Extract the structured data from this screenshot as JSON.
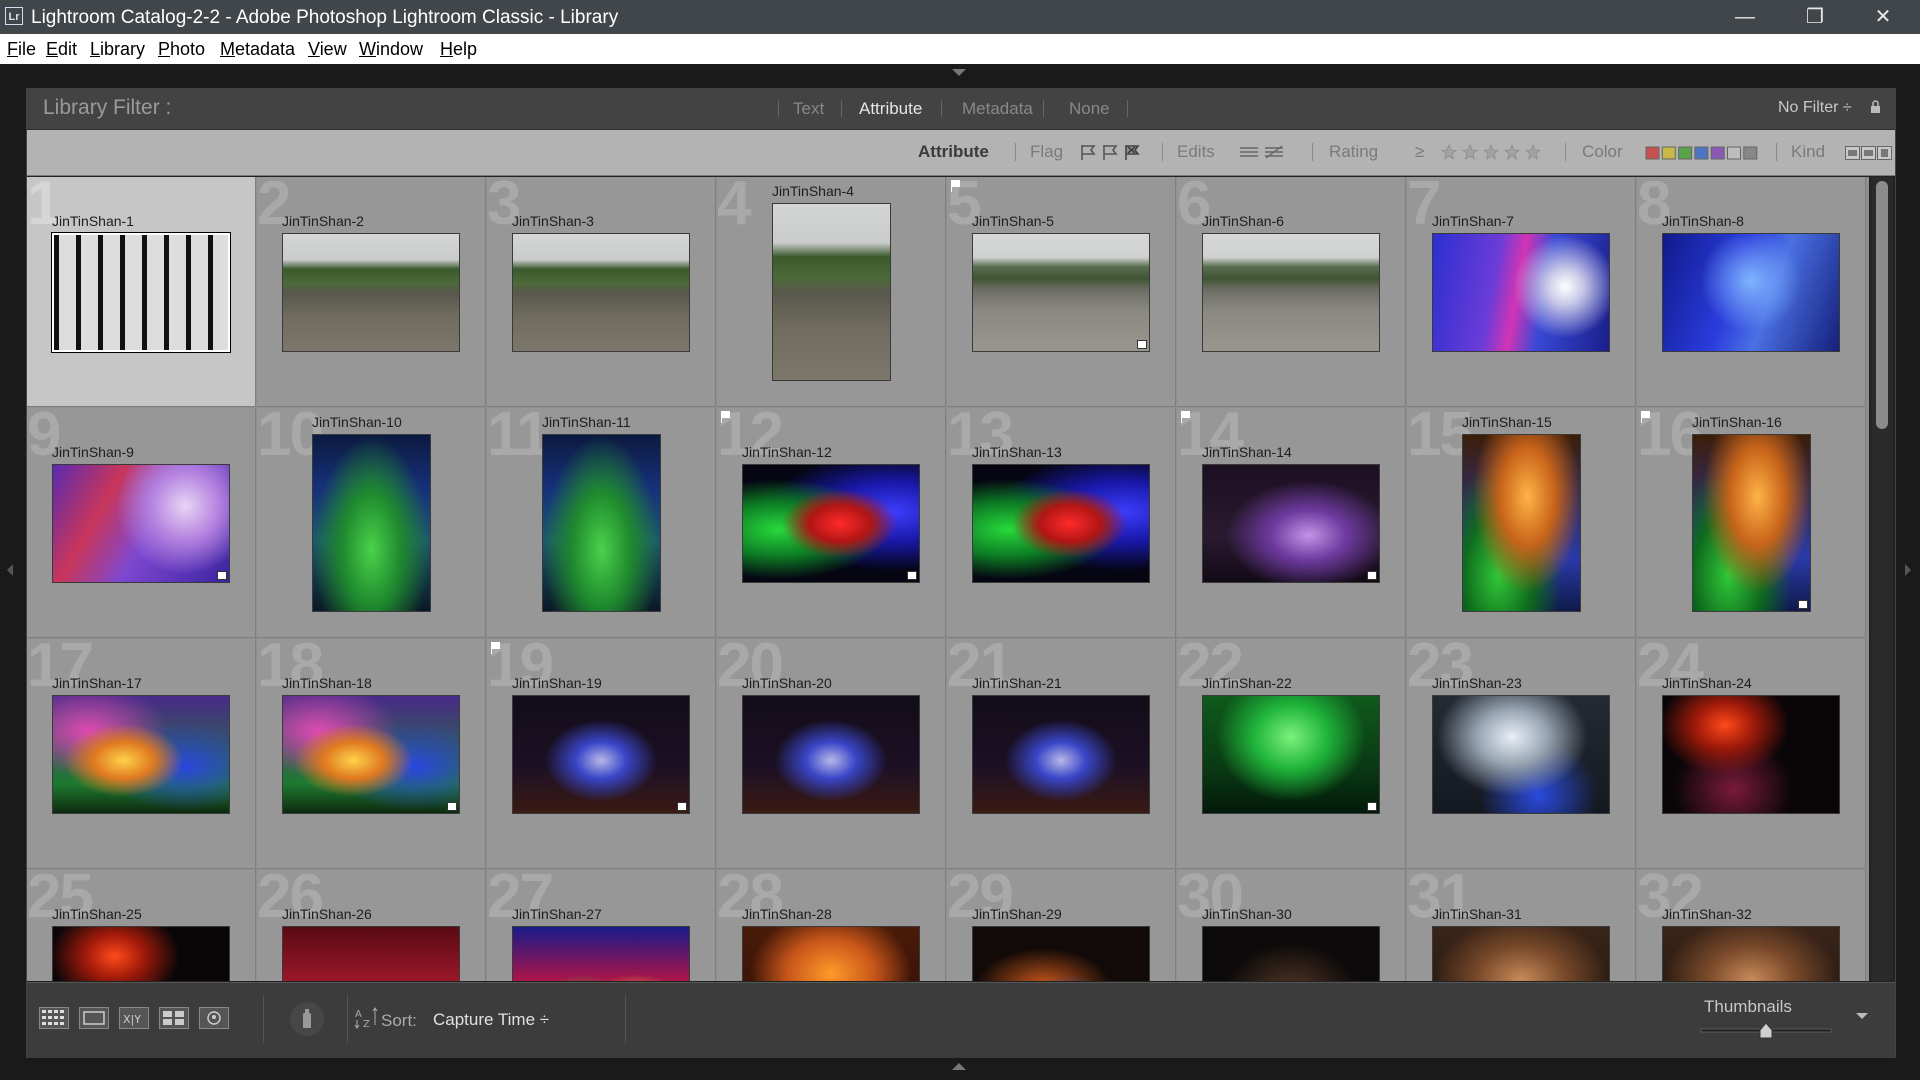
{
  "window": {
    "logo_text": "Lr",
    "title": "Lightroom Catalog-2-2 - Adobe Photoshop Lightroom Classic - Library",
    "controls": {
      "minimize": "—",
      "restore": "❐",
      "close": "✕"
    }
  },
  "menu": [
    "File",
    "Edit",
    "Library",
    "Photo",
    "Metadata",
    "View",
    "Window",
    "Help"
  ],
  "filter_bar": {
    "label": "Library Filter :",
    "tabs": [
      "Text",
      "Attribute",
      "Metadata",
      "None"
    ],
    "active_tab": "Attribute",
    "preset": "No Filter ÷"
  },
  "attribute_bar": {
    "title": "Attribute",
    "flag_label": "Flag",
    "edits_label": "Edits",
    "rating_label": "Rating",
    "rating_op": "≥",
    "color_label": "Color",
    "kind_label": "Kind",
    "color_swatches": [
      "#c75050",
      "#c8b847",
      "#5aa34b",
      "#4e74c2",
      "#8a58b5",
      "#bdbdbd",
      "#888888"
    ]
  },
  "photos": [
    {
      "num": "1",
      "name": "JinTinShan-1",
      "orientation": "landscape",
      "scene": "lattice",
      "selected": true
    },
    {
      "num": "2",
      "name": "JinTinShan-2",
      "orientation": "landscape",
      "scene": "lake"
    },
    {
      "num": "3",
      "name": "JinTinShan-3",
      "orientation": "landscape",
      "scene": "lake"
    },
    {
      "num": "4",
      "name": "JinTinShan-4",
      "orientation": "portrait",
      "scene": "lake"
    },
    {
      "num": "5",
      "name": "JinTinShan-5",
      "orientation": "landscape",
      "scene": "lake2",
      "flag": true,
      "badge": true
    },
    {
      "num": "6",
      "name": "JinTinShan-6",
      "orientation": "landscape",
      "scene": "lake2"
    },
    {
      "num": "7",
      "name": "JinTinShan-7",
      "orientation": "landscape",
      "scene": "cave-blue"
    },
    {
      "num": "8",
      "name": "JinTinShan-8",
      "orientation": "landscape",
      "scene": "cave-blue2"
    },
    {
      "num": "9",
      "name": "JinTinShan-9",
      "orientation": "landscape",
      "scene": "cave-purple",
      "badge": true
    },
    {
      "num": "10",
      "name": "JinTinShan-10",
      "orientation": "portrait",
      "scene": "cave-green-portrait"
    },
    {
      "num": "11",
      "name": "JinTinShan-11",
      "orientation": "portrait",
      "scene": "cave-green-portrait"
    },
    {
      "num": "12",
      "name": "JinTinShan-12",
      "orientation": "landscape",
      "scene": "cave-rgb",
      "flag": true,
      "badge": true
    },
    {
      "num": "13",
      "name": "JinTinShan-13",
      "orientation": "landscape",
      "scene": "cave-rgb"
    },
    {
      "num": "14",
      "name": "JinTinShan-14",
      "orientation": "landscape",
      "scene": "cave-dark-purple",
      "flag": true,
      "badge": true
    },
    {
      "num": "15",
      "name": "JinTinShan-15",
      "orientation": "portrait",
      "scene": "cave-orange-portrait"
    },
    {
      "num": "16",
      "name": "JinTinShan-16",
      "orientation": "portrait",
      "scene": "cave-orange-portrait",
      "flag": true,
      "badge": true
    },
    {
      "num": "17",
      "name": "JinTinShan-17",
      "orientation": "landscape",
      "scene": "cave-multi"
    },
    {
      "num": "18",
      "name": "JinTinShan-18",
      "orientation": "landscape",
      "scene": "cave-multi",
      "badge": true
    },
    {
      "num": "19",
      "name": "JinTinShan-19",
      "orientation": "landscape",
      "scene": "cave-dark-blue",
      "flag": true,
      "badge": true
    },
    {
      "num": "20",
      "name": "JinTinShan-20",
      "orientation": "landscape",
      "scene": "cave-dark-blue"
    },
    {
      "num": "21",
      "name": "JinTinShan-21",
      "orientation": "landscape",
      "scene": "cave-dark-blue"
    },
    {
      "num": "22",
      "name": "JinTinShan-22",
      "orientation": "landscape",
      "scene": "cave-green",
      "badge": true
    },
    {
      "num": "23",
      "name": "JinTinShan-23",
      "orientation": "landscape",
      "scene": "cave-white"
    },
    {
      "num": "24",
      "name": "JinTinShan-24",
      "orientation": "landscape",
      "scene": "cave-red-dark"
    },
    {
      "num": "25",
      "name": "JinTinShan-25",
      "orientation": "landscape",
      "scene": "cave-red-dark"
    },
    {
      "num": "26",
      "name": "JinTinShan-26",
      "orientation": "landscape",
      "scene": "cave-red"
    },
    {
      "num": "27",
      "name": "JinTinShan-27",
      "orientation": "landscape",
      "scene": "cave-rgb2"
    },
    {
      "num": "28",
      "name": "JinTinShan-28",
      "orientation": "landscape",
      "scene": "cave-orange"
    },
    {
      "num": "29",
      "name": "JinTinShan-29",
      "orientation": "landscape",
      "scene": "cave-dark-orange"
    },
    {
      "num": "30",
      "name": "JinTinShan-30",
      "orientation": "landscape",
      "scene": "cave-dark"
    },
    {
      "num": "31",
      "name": "JinTinShan-31",
      "orientation": "landscape",
      "scene": "cave-brown"
    },
    {
      "num": "32",
      "name": "JinTinShan-32",
      "orientation": "landscape",
      "scene": "cave-brown"
    }
  ],
  "toolbar": {
    "sort_label": "Sort:",
    "sort_value": "Capture Time ÷",
    "thumbnails_label": "Thumbnails",
    "thumbnail_size": 0.5
  }
}
